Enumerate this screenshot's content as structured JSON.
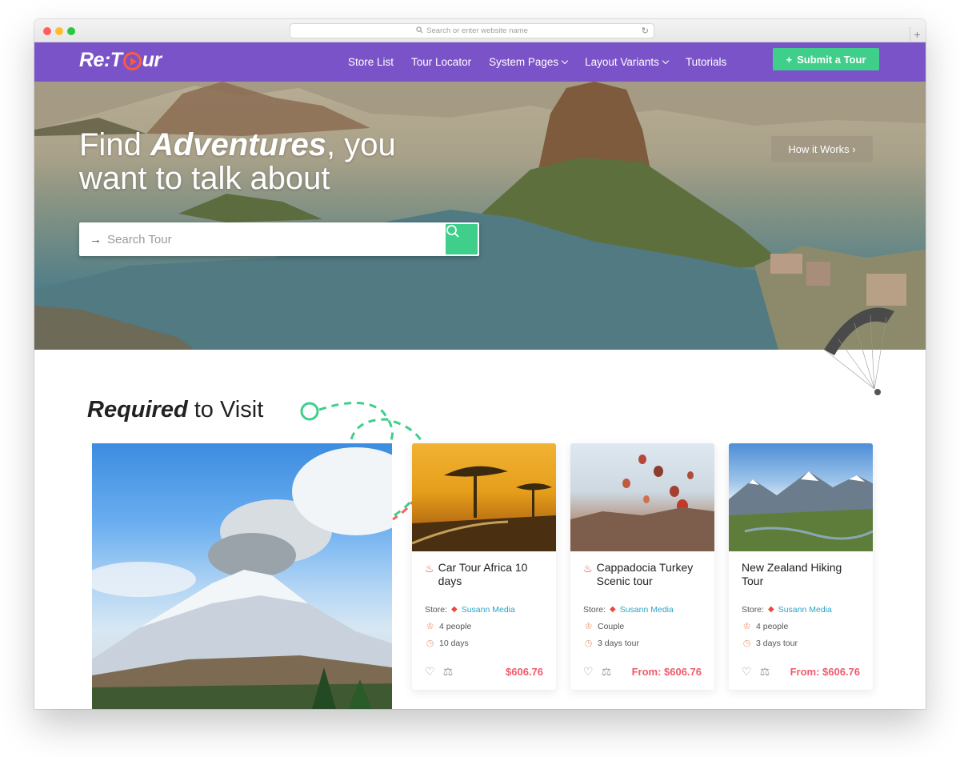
{
  "browser": {
    "address_placeholder": "Search or enter website name"
  },
  "nav": {
    "logo_left": "Re:T",
    "logo_right": "ur",
    "items": [
      {
        "label": "Store List",
        "dropdown": false
      },
      {
        "label": "Tour Locator",
        "dropdown": false
      },
      {
        "label": "System Pages",
        "dropdown": true
      },
      {
        "label": "Layout Variants",
        "dropdown": true
      },
      {
        "label": "Tutorials",
        "dropdown": false
      }
    ],
    "submit_label": "Submit a Tour"
  },
  "hero": {
    "title_prefix": "Find ",
    "title_emphasis": "Adventures",
    "title_suffix": ", you",
    "title_line2": "want to talk about",
    "how_it_works_label": "How it Works ›",
    "search_placeholder": "Search Tour"
  },
  "section": {
    "title_emphasis": "Required",
    "title_rest": " to Visit"
  },
  "tours": [
    {
      "title": "Car Tour Africa 10 days",
      "hot": true,
      "store_label": "Store:",
      "store_name": "Susann Media",
      "people": "4 people",
      "duration": "10 days",
      "price": "$606.76"
    },
    {
      "title": "Cappadocia Turkey Scenic tour",
      "hot": true,
      "store_label": "Store:",
      "store_name": "Susann Media",
      "people": "Couple",
      "duration": "3 days tour",
      "price": "From: $606.76"
    },
    {
      "title": "New Zealand Hiking Tour",
      "hot": false,
      "store_label": "Store:",
      "store_name": "Susann Media",
      "people": "4 people",
      "duration": "3 days tour",
      "price": "From: $606.76"
    }
  ],
  "colors": {
    "nav_bg": "#7b53c9",
    "accent_green": "#3fcf8a",
    "logo_orange": "#ff5a36",
    "price_red": "#f05a6b",
    "store_link": "#2aa4c8"
  }
}
